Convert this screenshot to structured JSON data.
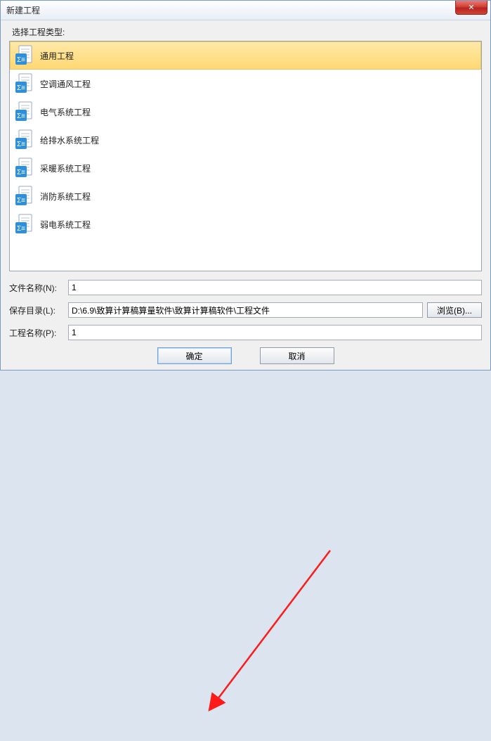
{
  "titlebar": {
    "title": "新建工程",
    "close_glyph": "✕"
  },
  "prompt": "选择工程类型:",
  "project_types": [
    {
      "label": "通用工程",
      "selected": true
    },
    {
      "label": "空调通风工程",
      "selected": false
    },
    {
      "label": "电气系统工程",
      "selected": false
    },
    {
      "label": "给排水系统工程",
      "selected": false
    },
    {
      "label": "采暖系统工程",
      "selected": false
    },
    {
      "label": "消防系统工程",
      "selected": false
    },
    {
      "label": "弱电系统工程",
      "selected": false
    }
  ],
  "fields": {
    "filename": {
      "label": "文件名称(N):",
      "value": "1"
    },
    "savedir": {
      "label": "保存目录(L):",
      "value": "D:\\6.9\\致算计算稿算量软件\\致算计算稿软件\\工程文件"
    },
    "projectname": {
      "label": "工程名称(P):",
      "value": "1"
    }
  },
  "buttons": {
    "browse": "浏览(B)...",
    "ok": "确定",
    "cancel": "取消"
  },
  "icon_color": "#2f8fd8"
}
